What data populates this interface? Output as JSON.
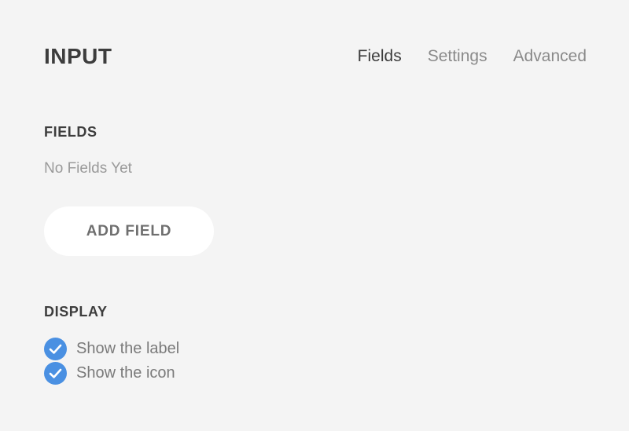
{
  "header": {
    "title": "INPUT",
    "tabs": [
      {
        "label": "Fields",
        "active": true
      },
      {
        "label": "Settings",
        "active": false
      },
      {
        "label": "Advanced",
        "active": false
      }
    ]
  },
  "fields": {
    "heading": "FIELDS",
    "empty_text": "No Fields Yet",
    "add_button_label": "ADD FIELD"
  },
  "display": {
    "heading": "DISPLAY",
    "options": [
      {
        "label": "Show the label",
        "checked": true,
        "icon": "checkmark-icon"
      },
      {
        "label": "Show the icon",
        "checked": true,
        "icon": "checkmark-icon"
      }
    ]
  },
  "colors": {
    "background": "#f4f4f4",
    "accent": "#4a90e2",
    "button_bg": "#ffffff"
  }
}
